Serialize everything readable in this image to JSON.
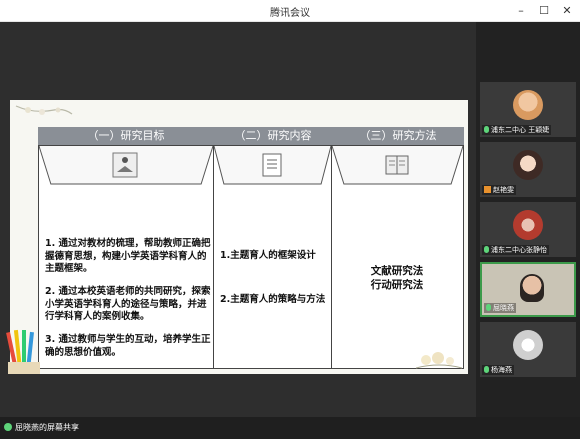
{
  "window": {
    "title": "腾讯会议"
  },
  "slide": {
    "headers": [
      "（一）研究目标",
      "（二）研究内容",
      "（三）研究方法"
    ],
    "goals": [
      "1. 通过对教材的梳理，帮助教师正确把握德育思想，构建小学英语学科育人的主题框架。",
      "2. 通过本校英语老师的共同研究，探索小学英语学科育人的途径与策略，并进行学科育人的案例收集。",
      "3. 通过教师与学生的互动，培养学生正确的思想价值观。"
    ],
    "contents": [
      "1.主题育人的框架设计",
      "2.主题育人的策略与方法"
    ],
    "methods": [
      "文献研究法",
      "行动研究法"
    ]
  },
  "participants": [
    {
      "name": "浦东二中心 王颖婕"
    },
    {
      "name": "赵艳雯"
    },
    {
      "name": "浦东二中心张静怡"
    },
    {
      "name": "屈晓燕"
    },
    {
      "name": "杨海燕"
    }
  ],
  "status": {
    "screen_share": "屈晓燕的屏幕共享"
  },
  "colors": {
    "header_bg": "#8a8f96",
    "active_border": "#3c9a4a",
    "mic_green": "#5ed47a"
  }
}
